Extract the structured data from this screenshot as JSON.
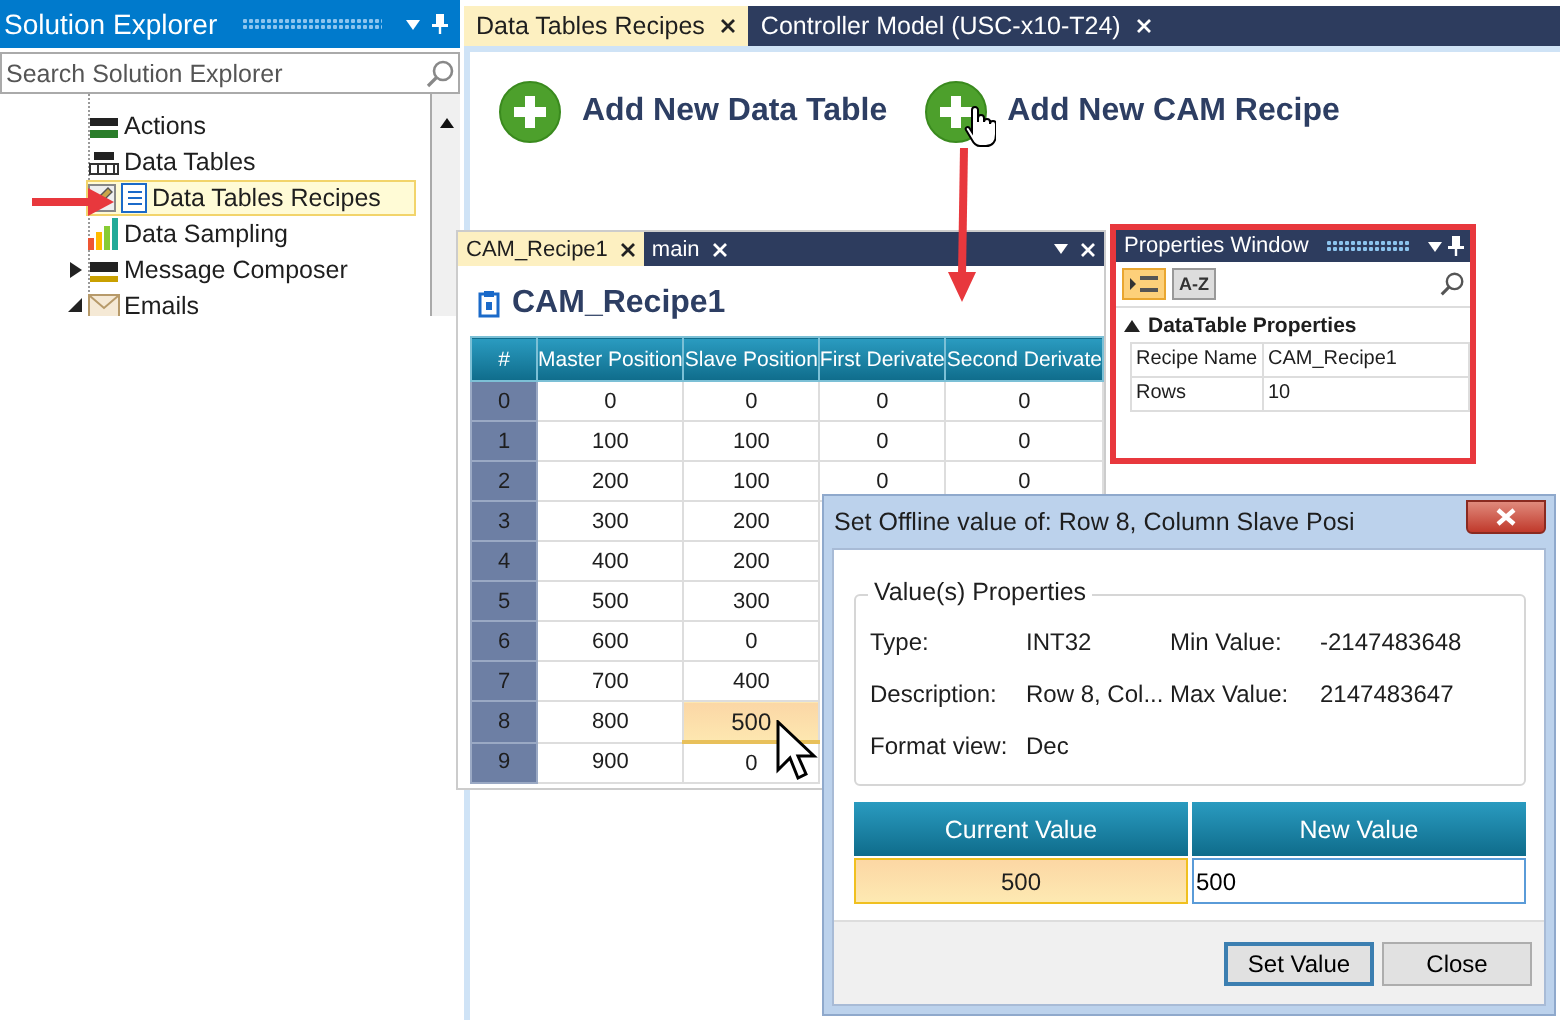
{
  "solution_explorer": {
    "title": "Solution Explorer",
    "search_placeholder": "Search Solution Explorer",
    "items": [
      {
        "label": "Actions",
        "selected": false
      },
      {
        "label": "Data Tables",
        "selected": false
      },
      {
        "label": "Data Tables Recipes",
        "selected": true
      },
      {
        "label": "Data Sampling",
        "selected": false
      },
      {
        "label": "Message Composer",
        "selected": false,
        "expanded": false
      },
      {
        "label": "Emails",
        "selected": false,
        "expanded": true
      }
    ]
  },
  "document_tabs": [
    {
      "label": "Data Tables Recipes",
      "selected": true
    },
    {
      "label": "Controller Model (USC-x10-T24)",
      "selected": false
    }
  ],
  "actions": [
    {
      "label": "Add New Data Table"
    },
    {
      "label": "Add New CAM Recipe"
    }
  ],
  "recipe_window": {
    "tabs": [
      {
        "label": "CAM_Recipe1",
        "selected": true
      },
      {
        "label": "main",
        "selected": false
      }
    ],
    "title": "CAM_Recipe1",
    "row_header_column": "#",
    "columns": [
      "Master Position",
      "Slave Position",
      "First Derivate",
      "Second Derivate"
    ],
    "rows": [
      {
        "index": "0",
        "cells": [
          {
            "text": "0",
            "selected": false
          },
          {
            "text": "0",
            "selected": false
          },
          {
            "text": "0",
            "selected": false
          },
          {
            "text": "0",
            "selected": false
          }
        ]
      },
      {
        "index": "1",
        "cells": [
          {
            "text": "100",
            "selected": false
          },
          {
            "text": "100",
            "selected": false
          },
          {
            "text": "0",
            "selected": false
          },
          {
            "text": "0",
            "selected": false
          }
        ]
      },
      {
        "index": "2",
        "cells": [
          {
            "text": "200",
            "selected": false
          },
          {
            "text": "100",
            "selected": false
          },
          {
            "text": "0",
            "selected": false
          },
          {
            "text": "0",
            "selected": false
          }
        ]
      },
      {
        "index": "3",
        "cells": [
          {
            "text": "300",
            "selected": false
          },
          {
            "text": "200",
            "selected": false
          }
        ]
      },
      {
        "index": "4",
        "cells": [
          {
            "text": "400",
            "selected": false
          },
          {
            "text": "200",
            "selected": false
          }
        ]
      },
      {
        "index": "5",
        "cells": [
          {
            "text": "500",
            "selected": false
          },
          {
            "text": "300",
            "selected": false
          }
        ]
      },
      {
        "index": "6",
        "cells": [
          {
            "text": "600",
            "selected": false
          },
          {
            "text": "0",
            "selected": false
          }
        ]
      },
      {
        "index": "7",
        "cells": [
          {
            "text": "700",
            "selected": false
          },
          {
            "text": "400",
            "selected": false
          }
        ]
      },
      {
        "index": "8",
        "cells": [
          {
            "text": "800",
            "selected": false
          },
          {
            "text": "500",
            "selected": true
          }
        ]
      },
      {
        "index": "9",
        "cells": [
          {
            "text": "900",
            "selected": false
          },
          {
            "text": "0",
            "selected": false
          }
        ]
      }
    ]
  },
  "properties_window": {
    "title": "Properties Window",
    "toolbar": [
      {
        "kind": "categorized",
        "selected": true
      },
      {
        "kind": "alphabetical",
        "label": "A-Z",
        "selected": false
      }
    ],
    "section": {
      "title": "DataTable Properties",
      "expanded": true
    },
    "rows": [
      {
        "name": "Recipe Name",
        "value": "CAM_Recipe1"
      },
      {
        "name": "Rows",
        "value": "10"
      }
    ]
  },
  "dialog": {
    "title": "Set Offline value of: Row 8, Column Slave Posi",
    "group_title": "Value(s) Properties",
    "fields": [
      {
        "label": "Type:",
        "value": "INT32"
      },
      {
        "label": "Min Value:",
        "value": "-2147483648"
      },
      {
        "label": "Description:",
        "value": "Row 8, Col..."
      },
      {
        "label": "Max Value:",
        "value": "2147483647"
      },
      {
        "label": "Format view:",
        "value": "Dec"
      }
    ],
    "columns": [
      "Current Value",
      "New Value"
    ],
    "current_value": "500",
    "new_value": "500",
    "buttons": [
      {
        "label": "Set Value",
        "default": true
      },
      {
        "label": "Close",
        "default": false
      }
    ]
  }
}
